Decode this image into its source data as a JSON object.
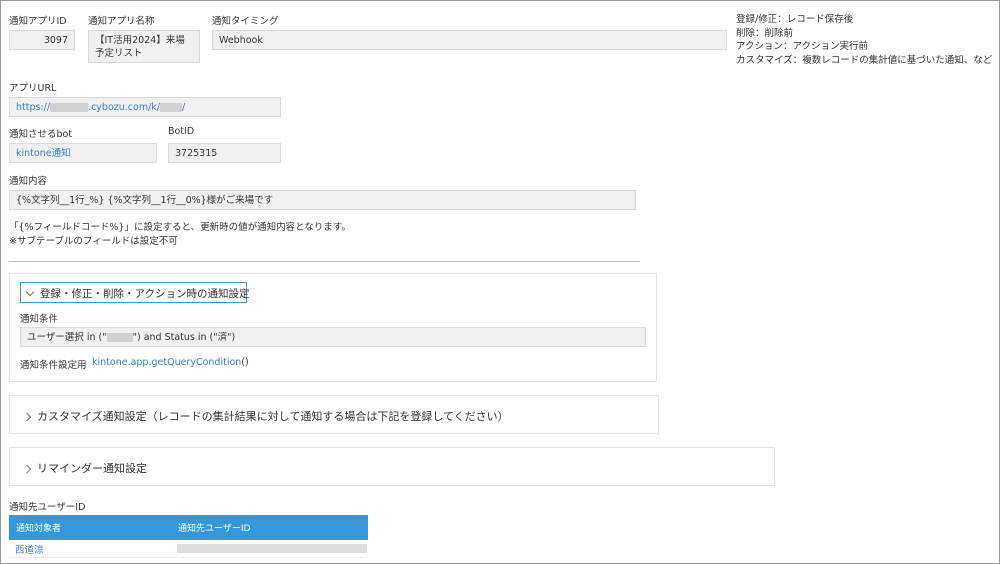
{
  "fields": {
    "app_id_label": "通知アプリID",
    "app_id_value": "3097",
    "app_name_label": "通知アプリ名称",
    "app_name_value": "【IT活用2024】来場予定リスト",
    "timing_label": "通知タイミング",
    "timing_value": "Webhook",
    "timing_notes": [
      "登録/修正：レコード保存後",
      "削除：削除前",
      "アクション：アクション実行前",
      "カスタマイズ：複数レコードの集計値に基づいた通知、など"
    ],
    "app_url_label": "アプリURL",
    "app_url_prefix": "https://",
    "app_url_middle": ".cybozu.com/k/",
    "app_url_suffix": "/",
    "bot_label": "通知させるbot",
    "bot_value": "kintone通知",
    "botid_label": "BotID",
    "botid_value": "3725315",
    "content_label": "通知内容",
    "content_value": "{%文字列__1行_%} {%文字列__1行__0%}様がご来場です",
    "content_help_1": "「{%フィールドコード%}」に設定すると、更新時の値が通知内容となります。",
    "content_help_2": "※サブテーブルのフィールドは設定不可"
  },
  "sections": {
    "registration": {
      "title": "登録・修正・削除・アクション時の通知設定",
      "condition_label": "通知条件",
      "condition_prefix": "ユーザー選択 in (\"",
      "condition_suffix": "\") and Status in (\"済\")",
      "setting_label": "通知条件設定用",
      "setting_link": "kintone.app.getQueryCondition",
      "setting_parens": "()"
    },
    "customize": {
      "title": "カスタマイズ通知設定（レコードの集計結果に対して通知する場合は下記を登録してください）"
    },
    "reminder": {
      "title": "リマインダー通知設定"
    }
  },
  "users": {
    "title": "通知先ユーザーID",
    "headers": [
      "通知対象者",
      "通知先ユーザーID"
    ],
    "rows": [
      {
        "name": "西道涼"
      }
    ]
  },
  "colors": {
    "accent": "#3498db",
    "link": "#3b7dc4",
    "field_bg": "#f0f0f0"
  }
}
